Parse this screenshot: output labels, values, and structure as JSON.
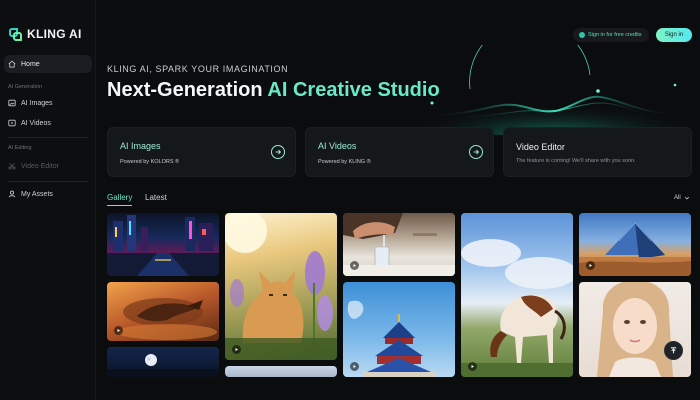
{
  "app": {
    "logo_text": "KLING AI"
  },
  "header": {
    "credits_label": "Sign in for free credits",
    "signin_label": "Sign in"
  },
  "sidebar": {
    "home": "Home",
    "section_generation": "AI Generation",
    "ai_images": "AI Images",
    "ai_videos": "AI Videos",
    "section_editing": "AI Editing",
    "video_editor": "Video Editor",
    "my_assets": "My Assets"
  },
  "hero": {
    "tagline": "KLING AI, SPARK YOUR IMAGINATION",
    "headline_plain": "Next-Generation ",
    "headline_accent": "AI Creative Studio"
  },
  "cards": [
    {
      "title": "AI Images",
      "subtitle": "Powered by KOLORS ®"
    },
    {
      "title": "AI Videos",
      "subtitle": "Powered by KLING ®"
    },
    {
      "title": "Video Editor",
      "subtitle": "The feature is coming! We'll share with you soon."
    }
  ],
  "gallery": {
    "tabs": [
      "Gallery",
      "Latest"
    ],
    "filter": "All",
    "items": [
      {
        "subject": "neon city street at night",
        "video": false
      },
      {
        "subject": "dragon in desert",
        "video": true
      },
      {
        "subject": "moon night scene",
        "video": false
      },
      {
        "subject": "kitten among flowers",
        "video": true
      },
      {
        "subject": "sky scene",
        "video": false
      },
      {
        "subject": "hands pouring water into glass",
        "video": true
      },
      {
        "subject": "temple under blue sky",
        "video": true
      },
      {
        "subject": "horse in meadow",
        "video": true
      },
      {
        "subject": "glass pyramid in desert",
        "video": true
      },
      {
        "subject": "portrait of woman",
        "video": false
      }
    ]
  },
  "colors": {
    "accent": "#68e9c8",
    "background": "#0b0c0e",
    "card": "#15181b"
  }
}
